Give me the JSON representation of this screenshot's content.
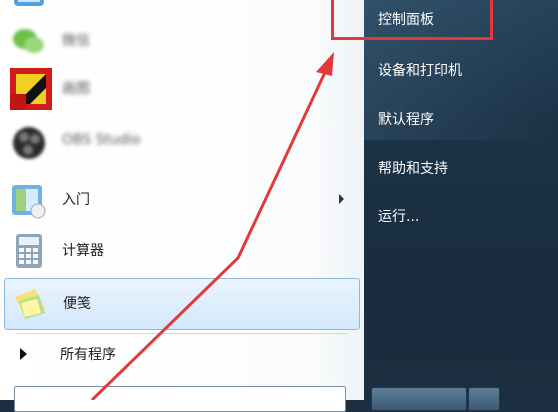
{
  "programs": [
    {
      "label": "",
      "blurred": true
    },
    {
      "label": "微信",
      "blurred": true
    },
    {
      "label": "画图",
      "blurred": true
    },
    {
      "label": "OBS Studio",
      "blurred": true
    },
    {
      "label": "入门",
      "blurred": false,
      "has_submenu": true
    },
    {
      "label": "计算器",
      "blurred": false
    },
    {
      "label": "便笺",
      "blurred": false,
      "highlighted": true
    }
  ],
  "all_programs_label": "所有程序",
  "right_items": [
    "控制面板",
    "设备和打印机",
    "默认程序",
    "帮助和支持",
    "运行..."
  ],
  "colors": {
    "annotation": "#e23a3a",
    "right_panel": "#1c3347"
  }
}
